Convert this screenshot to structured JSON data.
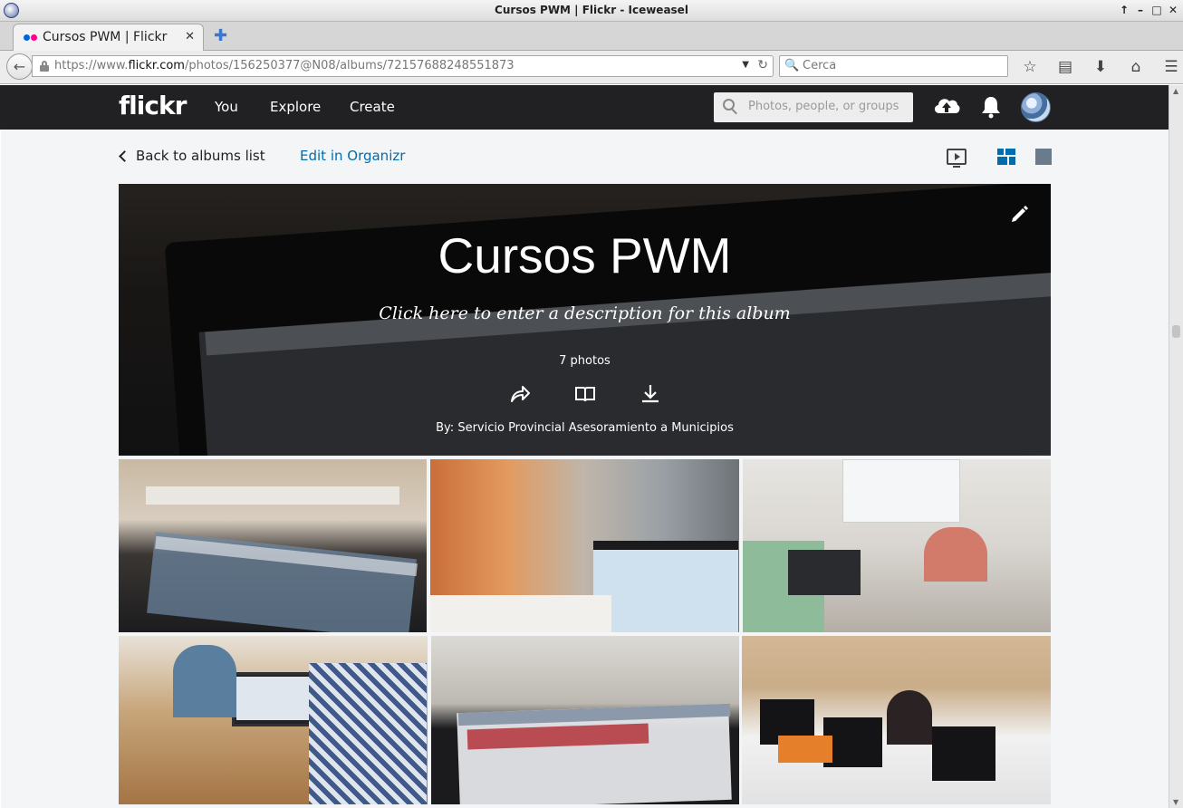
{
  "window": {
    "title": "Cursos PWM | Flickr - Iceweasel"
  },
  "browser": {
    "tab_title": "Cursos PWM | Flickr",
    "url_prefix": "https://www.",
    "url_host": "flickr.com",
    "url_path": "/photos/156250377@N08/albums/72157688248551873",
    "search_placeholder": "Cerca"
  },
  "flickr": {
    "logo": "flickr",
    "nav": [
      "You",
      "Explore",
      "Create"
    ],
    "search_placeholder": "Photos, people, or groups"
  },
  "subbar": {
    "back_label": "Back to albums list",
    "organizr_label": "Edit in Organizr"
  },
  "album": {
    "title": "Cursos PWM",
    "description_prompt": "Click here to enter a description for this album",
    "photo_count": "7 photos",
    "byline": "By: Servicio Provincial Asesoramiento a Municipios"
  },
  "colors": {
    "flickr_header": "#212124",
    "link_blue": "#006dac",
    "page_bg": "#f3f5f6"
  }
}
